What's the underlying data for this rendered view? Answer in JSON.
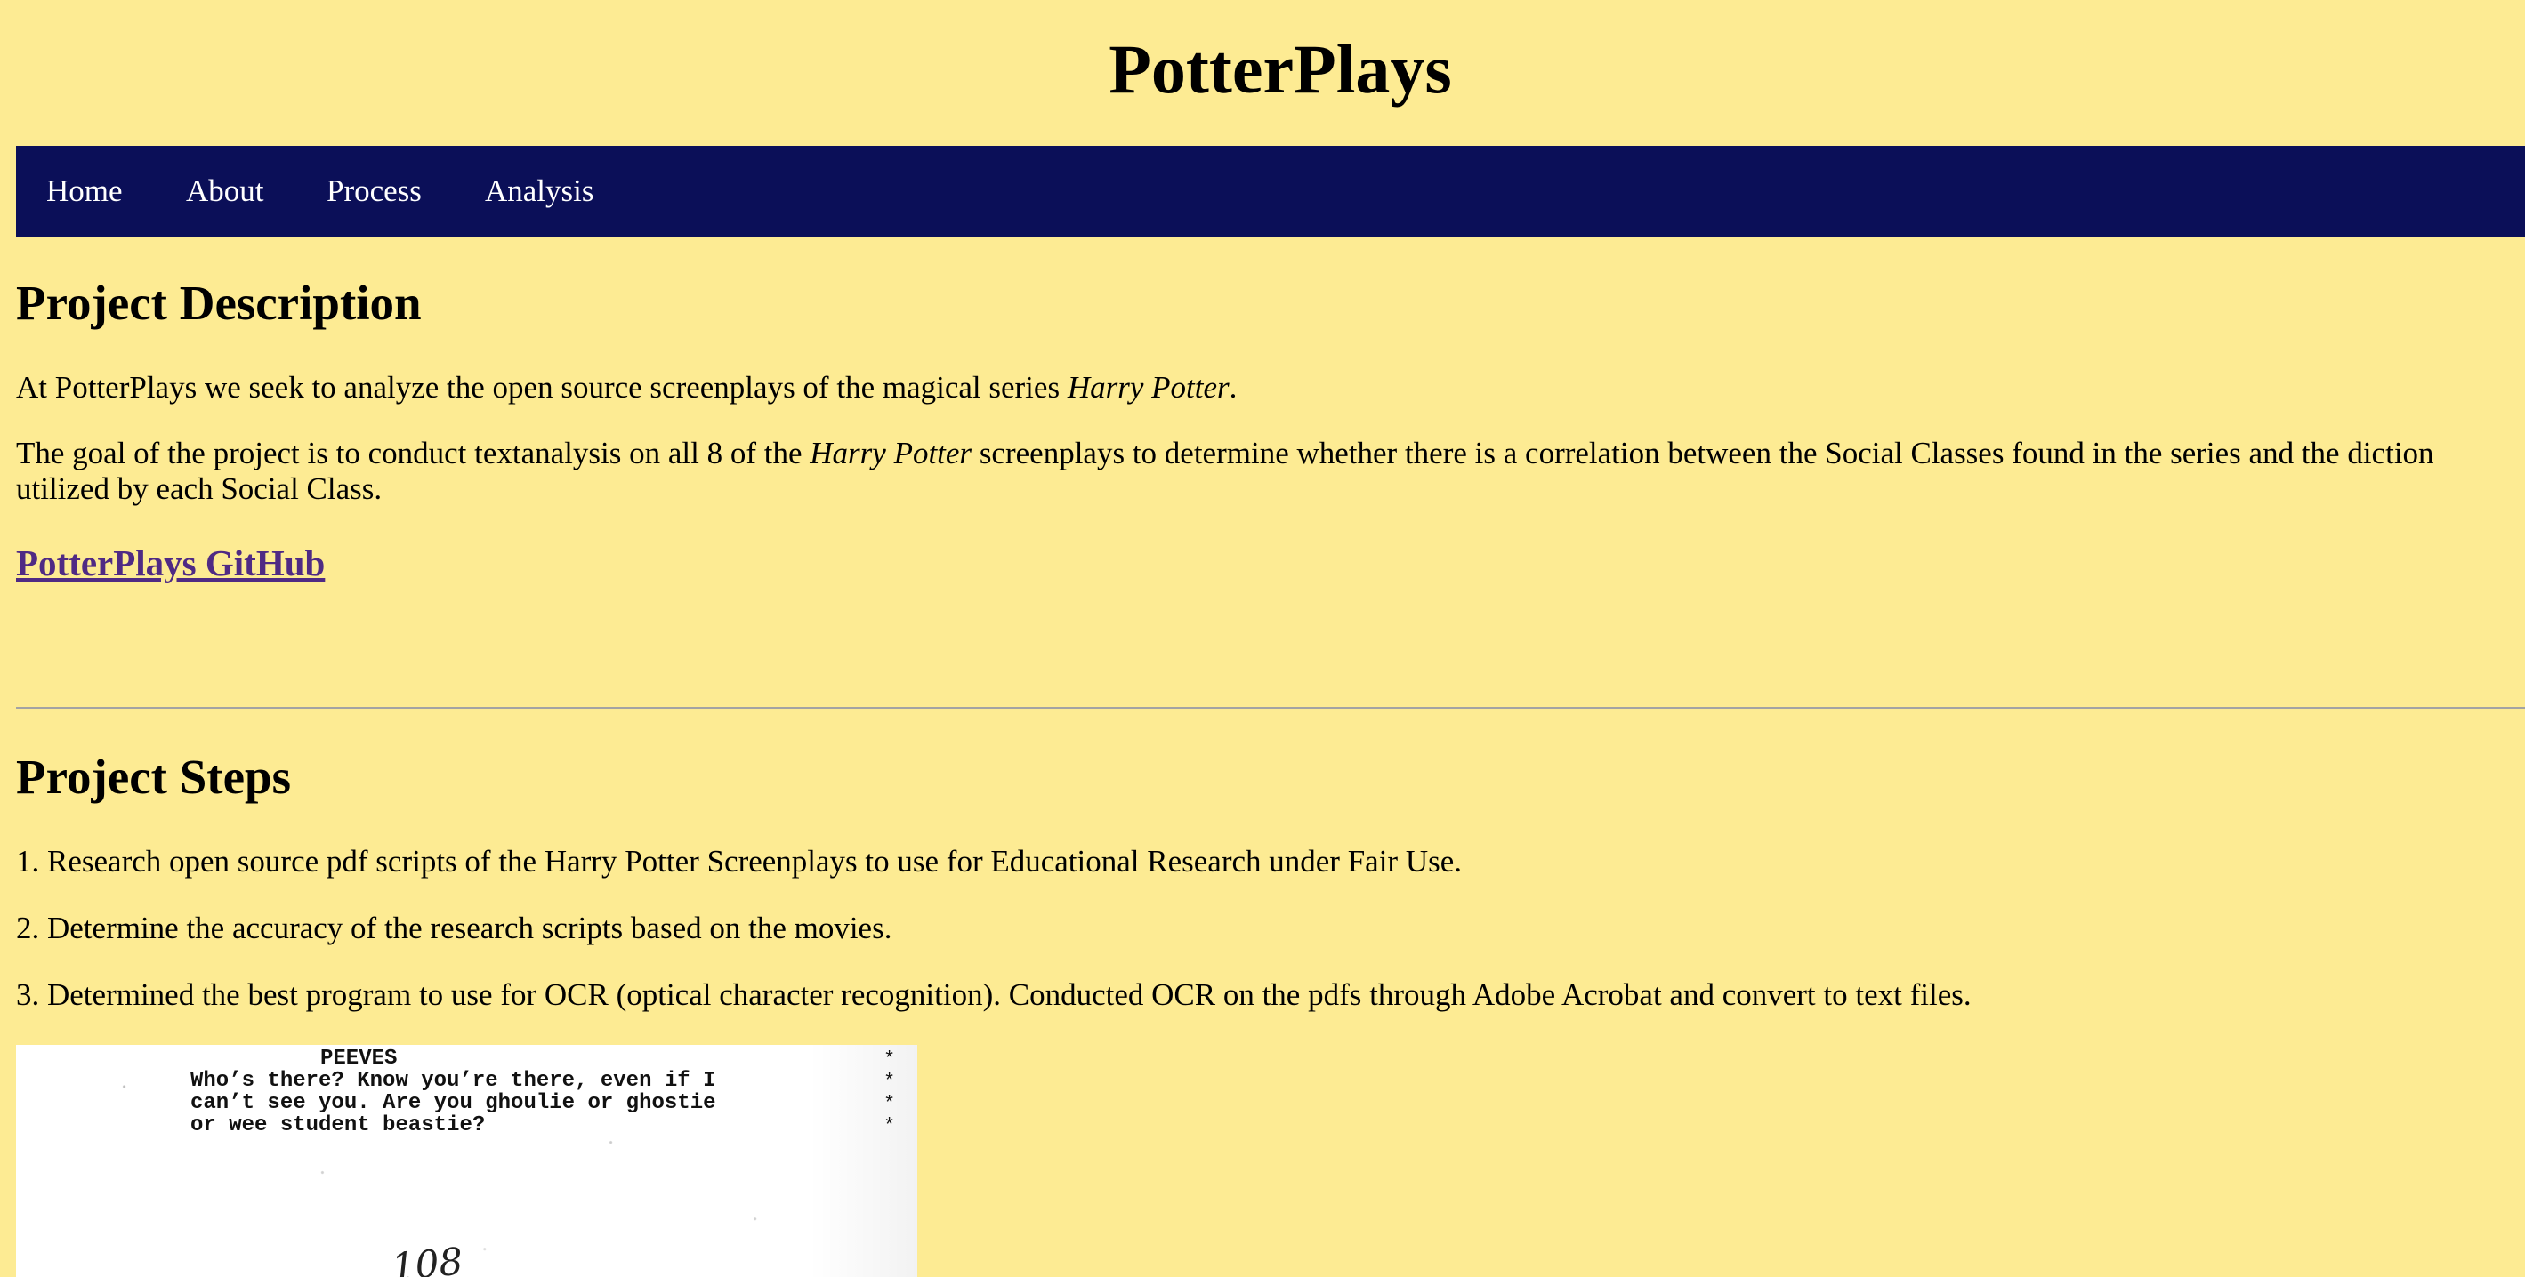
{
  "site": {
    "title": "PotterPlays"
  },
  "nav": {
    "items": [
      {
        "label": "Home"
      },
      {
        "label": "About"
      },
      {
        "label": "Process"
      },
      {
        "label": "Analysis"
      }
    ]
  },
  "description": {
    "heading": "Project Description",
    "intro_before": "At PotterPlays we seek to analyze the open source screenplays of the magical series ",
    "intro_title": "Harry Potter",
    "intro_after": ".",
    "goal_before": "The goal of the project is to conduct textanalysis on all 8 of the ",
    "goal_title": "Harry Potter",
    "goal_after": " screenplays to determine whether there is a correlation between the Social Classes found in the series and the diction utilized by each Social Class.",
    "github_link": "PotterPlays GitHub"
  },
  "steps": {
    "heading": "Project Steps",
    "items": [
      "1. Research open source pdf scripts of the Harry Potter Screenplays to use for Educational Research under Fair Use.",
      "2. Determine the accuracy of the research scripts based on the movies.",
      "3. Determined the best program to use for OCR (optical character recognition). Conducted OCR on the pdfs through Adobe Acrobat and convert to text files."
    ]
  },
  "script_image": {
    "speaker": "PEEVES",
    "lines": [
      "Who’s there? Know you’re there, even if I",
      "can’t see you. Are you ghoulie or ghostie",
      "or wee student beastie?"
    ],
    "stars": [
      "*",
      "*",
      "*",
      "*"
    ],
    "page_number": "108"
  }
}
